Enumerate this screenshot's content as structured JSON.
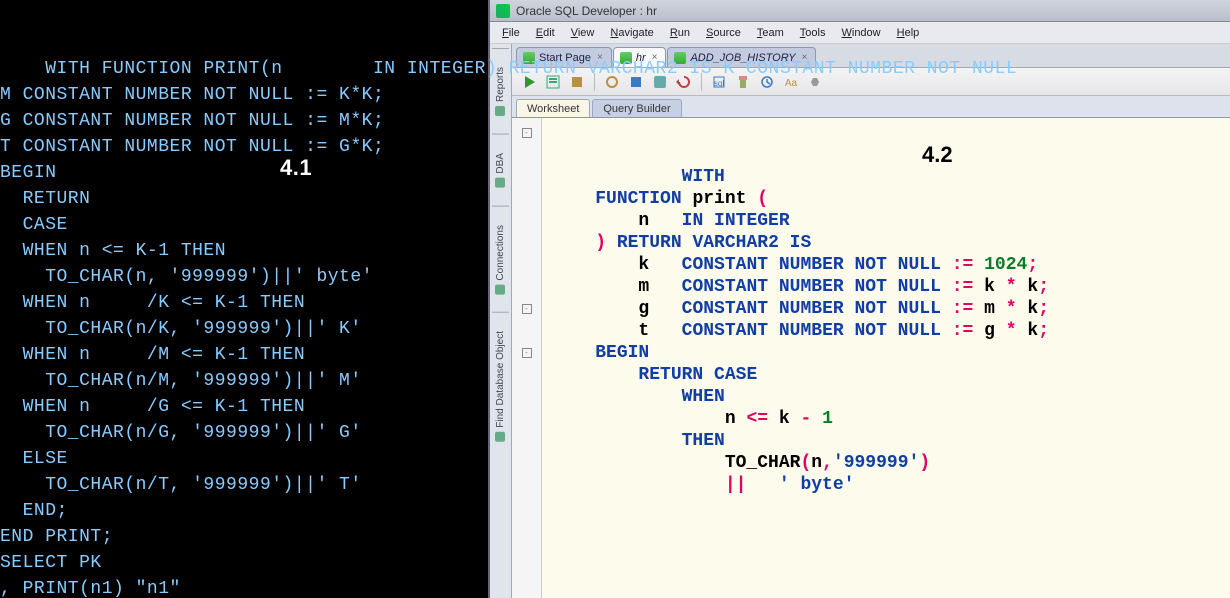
{
  "left": {
    "label": "4.1",
    "code": "WITH FUNCTION PRINT(n        IN INTEGER) RETURN VARCHAR2 IS K CONSTANT NUMBER NOT NULL\nM CONSTANT NUMBER NOT NULL := K*K;\nG CONSTANT NUMBER NOT NULL := M*K;\nT CONSTANT NUMBER NOT NULL := G*K;\nBEGIN\n  RETURN\n  CASE\n  WHEN n <= K-1 THEN\n    TO_CHAR(n, '999999')||' byte'\n  WHEN n     /K <= K-1 THEN\n    TO_CHAR(n/K, '999999')||' K'\n  WHEN n     /M <= K-1 THEN\n    TO_CHAR(n/M, '999999')||' M'\n  WHEN n     /G <= K-1 THEN\n    TO_CHAR(n/G, '999999')||' G'\n  ELSE\n    TO_CHAR(n/T, '999999')||' T'\n  END;\nEND PRINT;\nSELECT PK\n, PRINT(n1) \"n1\""
  },
  "right": {
    "title": "Oracle SQL Developer : hr",
    "label": "4.2",
    "menus": [
      "File",
      "Edit",
      "View",
      "Navigate",
      "Run",
      "Source",
      "Team",
      "Tools",
      "Window",
      "Help"
    ],
    "side_tabs": [
      "Reports",
      "DBA",
      "Connections",
      "Find Database Object"
    ],
    "doc_tabs": [
      {
        "label": "Start Page",
        "active": false,
        "closeable": true
      },
      {
        "label": "hr",
        "active": true,
        "closeable": true
      },
      {
        "label": "ADD_JOB_HISTORY",
        "active": false,
        "closeable": true
      }
    ],
    "ws_tabs": [
      {
        "label": "Worksheet",
        "active": true
      },
      {
        "label": "Query Builder",
        "active": false
      }
    ],
    "code_tokens": [
      [
        [
          "kw",
          "WITH"
        ]
      ],
      [
        [
          "pl",
          "    "
        ],
        [
          "kw",
          "FUNCTION"
        ],
        [
          "pl",
          " "
        ],
        [
          "id",
          "print"
        ],
        [
          "pl",
          " "
        ],
        [
          "op",
          "("
        ]
      ],
      [
        [
          "pl",
          "        "
        ],
        [
          "id",
          "n"
        ],
        [
          "pl",
          "   "
        ],
        [
          "kw",
          "IN INTEGER"
        ]
      ],
      [
        [
          "pl",
          "    "
        ],
        [
          "op",
          ")"
        ],
        [
          "pl",
          " "
        ],
        [
          "kw",
          "RETURN VARCHAR2 IS"
        ]
      ],
      [
        [
          "pl",
          "        "
        ],
        [
          "id",
          "k"
        ],
        [
          "pl",
          "   "
        ],
        [
          "kw",
          "CONSTANT NUMBER NOT NULL"
        ],
        [
          "pl",
          " "
        ],
        [
          "op",
          ":="
        ],
        [
          "pl",
          " "
        ],
        [
          "num",
          "1024"
        ],
        [
          "op",
          ";"
        ]
      ],
      [
        [
          "pl",
          "        "
        ],
        [
          "id",
          "m"
        ],
        [
          "pl",
          "   "
        ],
        [
          "kw",
          "CONSTANT NUMBER NOT NULL"
        ],
        [
          "pl",
          " "
        ],
        [
          "op",
          ":="
        ],
        [
          "pl",
          " "
        ],
        [
          "id",
          "k"
        ],
        [
          "pl",
          " "
        ],
        [
          "op",
          "*"
        ],
        [
          "pl",
          " "
        ],
        [
          "id",
          "k"
        ],
        [
          "op",
          ";"
        ]
      ],
      [
        [
          "pl",
          "        "
        ],
        [
          "id",
          "g"
        ],
        [
          "pl",
          "   "
        ],
        [
          "kw",
          "CONSTANT NUMBER NOT NULL"
        ],
        [
          "pl",
          " "
        ],
        [
          "op",
          ":="
        ],
        [
          "pl",
          " "
        ],
        [
          "id",
          "m"
        ],
        [
          "pl",
          " "
        ],
        [
          "op",
          "*"
        ],
        [
          "pl",
          " "
        ],
        [
          "id",
          "k"
        ],
        [
          "op",
          ";"
        ]
      ],
      [
        [
          "pl",
          "        "
        ],
        [
          "id",
          "t"
        ],
        [
          "pl",
          "   "
        ],
        [
          "kw",
          "CONSTANT NUMBER NOT NULL"
        ],
        [
          "pl",
          " "
        ],
        [
          "op",
          ":="
        ],
        [
          "pl",
          " "
        ],
        [
          "id",
          "g"
        ],
        [
          "pl",
          " "
        ],
        [
          "op",
          "*"
        ],
        [
          "pl",
          " "
        ],
        [
          "id",
          "k"
        ],
        [
          "op",
          ";"
        ]
      ],
      [
        [
          "pl",
          "    "
        ],
        [
          "kw",
          "BEGIN"
        ]
      ],
      [
        [
          "pl",
          "        "
        ],
        [
          "kw",
          "RETURN CASE"
        ]
      ],
      [
        [
          "pl",
          "            "
        ],
        [
          "kw",
          "WHEN"
        ]
      ],
      [
        [
          "pl",
          "                "
        ],
        [
          "id",
          "n"
        ],
        [
          "pl",
          " "
        ],
        [
          "op",
          "<="
        ],
        [
          "pl",
          " "
        ],
        [
          "id",
          "k"
        ],
        [
          "pl",
          " "
        ],
        [
          "op",
          "-"
        ],
        [
          "pl",
          " "
        ],
        [
          "num",
          "1"
        ]
      ],
      [
        [
          "pl",
          "            "
        ],
        [
          "kw",
          "THEN"
        ]
      ],
      [
        [
          "pl",
          "                "
        ],
        [
          "id",
          "TO_CHAR"
        ],
        [
          "op",
          "("
        ],
        [
          "id",
          "n"
        ],
        [
          "op",
          ","
        ],
        [
          "str",
          "'999999'"
        ],
        [
          "op",
          ")"
        ]
      ],
      [
        [
          "pl",
          "                "
        ],
        [
          "op",
          "||"
        ],
        [
          "pl",
          "   "
        ],
        [
          "str",
          "' byte'"
        ]
      ]
    ]
  }
}
